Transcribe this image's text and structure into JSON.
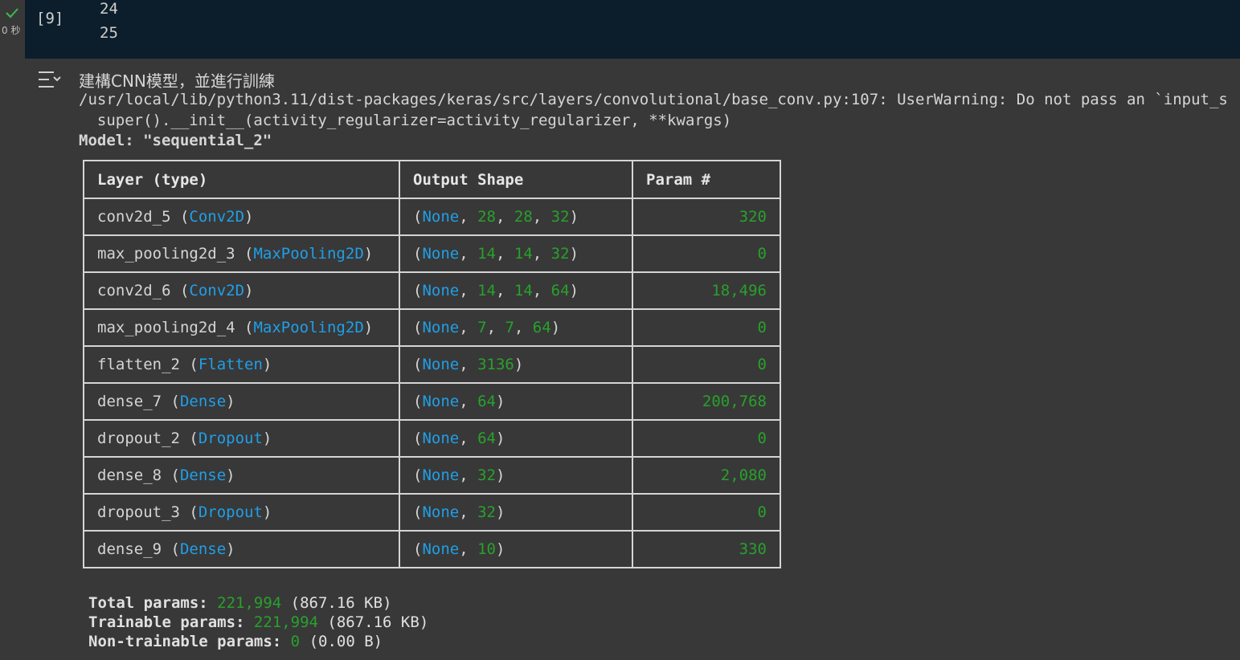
{
  "cell": {
    "exec_count": "[9]",
    "exec_time": "0 秒",
    "line_numbers": [
      "24",
      "25"
    ]
  },
  "output": {
    "heading": "建構CNN模型，並進行訓練",
    "warning_line1": "/usr/local/lib/python3.11/dist-packages/keras/src/layers/convolutional/base_conv.py:107: UserWarning: Do not pass an `input_s",
    "warning_line2": "  super().__init__(activity_regularizer=activity_regularizer, **kwargs)",
    "model_label": "Model: \"sequential_2\""
  },
  "summary": {
    "headers": [
      "Layer (type)",
      "Output Shape",
      "Param #"
    ],
    "rows": [
      {
        "name": "conv2d_5",
        "type": "Conv2D",
        "shape": [
          "None",
          "28",
          "28",
          "32"
        ],
        "params": "320"
      },
      {
        "name": "max_pooling2d_3",
        "type": "MaxPooling2D",
        "shape": [
          "None",
          "14",
          "14",
          "32"
        ],
        "params": "0"
      },
      {
        "name": "conv2d_6",
        "type": "Conv2D",
        "shape": [
          "None",
          "14",
          "14",
          "64"
        ],
        "params": "18,496"
      },
      {
        "name": "max_pooling2d_4",
        "type": "MaxPooling2D",
        "shape": [
          "None",
          "7",
          "7",
          "64"
        ],
        "params": "0"
      },
      {
        "name": "flatten_2",
        "type": "Flatten",
        "shape": [
          "None",
          "3136"
        ],
        "params": "0"
      },
      {
        "name": "dense_7",
        "type": "Dense",
        "shape": [
          "None",
          "64"
        ],
        "params": "200,768"
      },
      {
        "name": "dropout_2",
        "type": "Dropout",
        "shape": [
          "None",
          "64"
        ],
        "params": "0"
      },
      {
        "name": "dense_8",
        "type": "Dense",
        "shape": [
          "None",
          "32"
        ],
        "params": "2,080"
      },
      {
        "name": "dropout_3",
        "type": "Dropout",
        "shape": [
          "None",
          "32"
        ],
        "params": "0"
      },
      {
        "name": "dense_9",
        "type": "Dense",
        "shape": [
          "None",
          "10"
        ],
        "params": "330"
      }
    ]
  },
  "totals": {
    "total_label": "Total params: ",
    "total_value": "221,994",
    "total_size": " (867.16 KB)",
    "trainable_label": "Trainable params: ",
    "trainable_value": "221,994",
    "trainable_size": " (867.16 KB)",
    "nontrainable_label": "Non-trainable params: ",
    "nontrainable_value": "0",
    "nontrainable_size": " (0.00 B)"
  },
  "colors": {
    "type_name": "#1f9fe8",
    "number": "#28a12b",
    "code_bg": "#0c1e2b",
    "output_bg": "#383838"
  },
  "icons": {
    "status": "check-icon",
    "output_toggle": "output-collapse-icon"
  }
}
